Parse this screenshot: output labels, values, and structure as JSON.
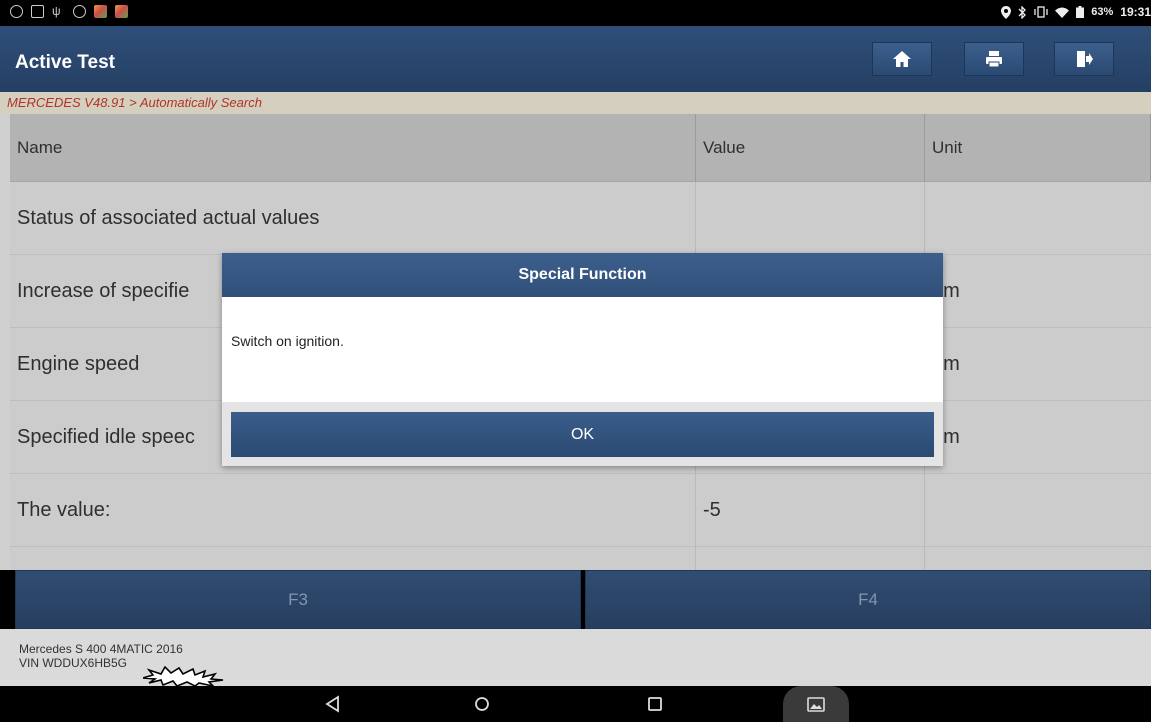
{
  "status_bar": {
    "battery": "63%",
    "time": "19:31"
  },
  "header": {
    "title": "Active Test",
    "buttons": [
      "home-icon",
      "print-icon",
      "exit-icon"
    ]
  },
  "breadcrumb": "MERCEDES V48.91 > Automatically Search",
  "table": {
    "columns": [
      "Name",
      "Value",
      "Unit"
    ],
    "rows": [
      {
        "name": "Status of associated actual values",
        "value": "",
        "unit": ""
      },
      {
        "name": "Increase of specifie",
        "value": "",
        "unit": "pm"
      },
      {
        "name": "Engine speed",
        "value": "",
        "unit": "pm"
      },
      {
        "name": "Specified idle speec",
        "value": "",
        "unit": "pm"
      },
      {
        "name": "The value:",
        "value": "-5",
        "unit": ""
      },
      {
        "name": "",
        "value": "",
        "unit": ""
      }
    ]
  },
  "function_keys": [
    "F3",
    "F4"
  ],
  "vehicle": {
    "model": "Mercedes S 400 4MATIC 2016",
    "vin": "VIN WDDUX6HB5G"
  },
  "dialog": {
    "title": "Special Function",
    "message": "Switch on ignition.",
    "ok_label": "OK"
  },
  "colors": {
    "header_blue": "#2a4a72",
    "breadcrumb_text": "#c0392b",
    "breadcrumb_bg": "#e7e1d0"
  }
}
